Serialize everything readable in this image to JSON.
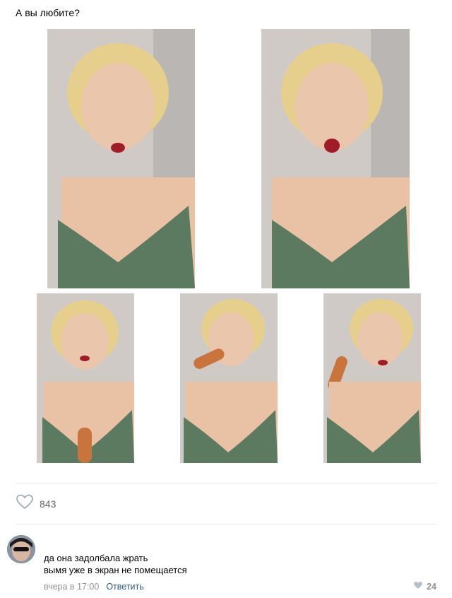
{
  "post": {
    "text": "А вы любите?",
    "photo_count": 5
  },
  "reactions": {
    "like_count": "843",
    "like_icon": "heart-outline-icon"
  },
  "comment": {
    "line1": "да она задолбала жрать",
    "line2": "вымя уже в экран не помещается",
    "time": "вчера в 17:00",
    "reply_label": "Ответить",
    "like_count": "24",
    "like_icon": "heart-filled-icon"
  },
  "colors": {
    "link": "#2a5885",
    "meta": "#939393",
    "divider": "#e7e8ec",
    "top_green": "#5c7a5f"
  }
}
